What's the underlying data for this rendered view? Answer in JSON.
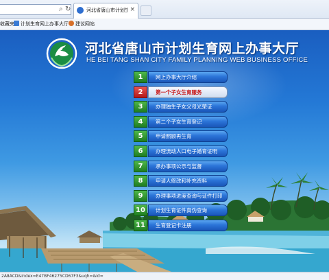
{
  "browser": {
    "address_icons": [
      "search-icon",
      "refresh-icon"
    ],
    "tab": {
      "title": "河北省唐山市计划生育网上...",
      "close": "×"
    },
    "favorites": [
      {
        "label": "收藏夹",
        "icon": "favorites-icon"
      },
      {
        "label": "计划生育网上办事大厅",
        "icon": "page-icon"
      },
      {
        "label": "建议网站",
        "icon": "suggested-sites-icon"
      }
    ],
    "status_url": "2A8ACD&index=E47BF46275CD67F3&uqh=&id="
  },
  "site": {
    "title": "河北省唐山市计划生育网上办事大厅",
    "subtitle": "HE BEI TANG SHAN CITY FAMILY PLANNING WEB BUSINESS OFFICE",
    "logo_icon": "family-planning-logo-icon"
  },
  "menu": [
    {
      "num": "1",
      "label": "网上办事大厅介绍",
      "active": false
    },
    {
      "num": "2",
      "label": "第一个子女生育服务",
      "active": true
    },
    {
      "num": "3",
      "label": "办理独生子女父母光荣证",
      "active": false
    },
    {
      "num": "4",
      "label": "第二个子女生育登记",
      "active": false
    },
    {
      "num": "5",
      "label": "申请照顾再生育",
      "active": false
    },
    {
      "num": "6",
      "label": "办理流动人口电子婚育证明",
      "active": false
    },
    {
      "num": "7",
      "label": "承办事项公示与监督",
      "active": false
    },
    {
      "num": "8",
      "label": "申请人修改和补充资料",
      "active": false
    },
    {
      "num": "9",
      "label": "办理事项进度查询与证件打印",
      "active": false
    },
    {
      "num": "10",
      "label": "计划生育证件真伪查询",
      "active": false
    },
    {
      "num": "11",
      "label": "生育登记卡注册",
      "active": false
    }
  ],
  "colors": {
    "menu_number_bg": "#2f9a33",
    "menu_active_number_bg": "#d0302f",
    "menu_bar": "#2b74d8",
    "active_label": "#c81212",
    "sky": "#2479d6"
  }
}
